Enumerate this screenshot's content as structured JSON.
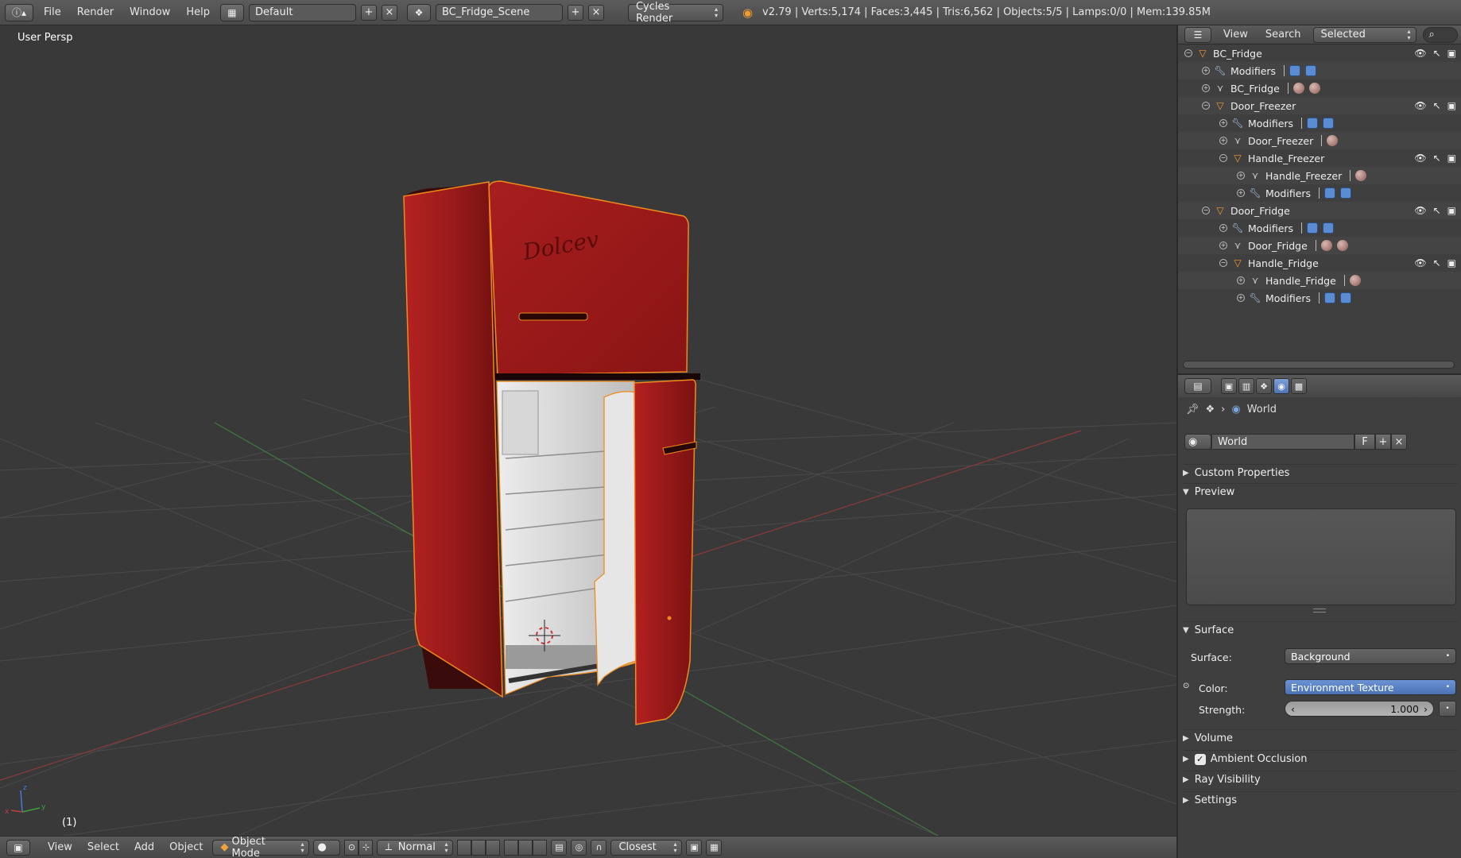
{
  "topbar": {
    "menus": [
      "File",
      "Render",
      "Window",
      "Help"
    ],
    "layout_value": "Default",
    "scene_value": "BC_Fridge_Scene",
    "engine_value": "Cycles Render",
    "stats": "v2.79 | Verts:5,174 | Faces:3,445 | Tris:6,562 | Objects:5/5 | Lamps:0/0 | Mem:139.85M"
  },
  "viewport": {
    "label": "User Persp",
    "frame": "(1)",
    "fridge_brand": "Dolcev"
  },
  "bottombar": {
    "menus": [
      "View",
      "Select",
      "Add",
      "Object"
    ],
    "mode": "Object Mode",
    "pivot": "Normal",
    "snap": "Closest"
  },
  "outliner": {
    "header": {
      "view": "View",
      "search": "Search",
      "filter": "Selected"
    },
    "rows": [
      {
        "label": "BC_Fridge",
        "type": "object",
        "depth": 0,
        "expanded": true,
        "vis": true,
        "extra": "none"
      },
      {
        "label": "Modifiers",
        "type": "modifiers",
        "depth": 1,
        "expanded": false,
        "vis": false,
        "extra": "mods"
      },
      {
        "label": "BC_Fridge",
        "type": "mesh",
        "depth": 1,
        "expanded": false,
        "vis": false,
        "extra": "mats2"
      },
      {
        "label": "Door_Freezer",
        "type": "object",
        "depth": 1,
        "expanded": true,
        "vis": true,
        "extra": "none"
      },
      {
        "label": "Modifiers",
        "type": "modifiers",
        "depth": 2,
        "expanded": false,
        "vis": false,
        "extra": "mods"
      },
      {
        "label": "Door_Freezer",
        "type": "mesh",
        "depth": 2,
        "expanded": false,
        "vis": false,
        "extra": "mats1"
      },
      {
        "label": "Handle_Freezer",
        "type": "object",
        "depth": 2,
        "expanded": true,
        "vis": true,
        "extra": "none"
      },
      {
        "label": "Handle_Freezer",
        "type": "mesh",
        "depth": 3,
        "expanded": false,
        "vis": false,
        "extra": "mats1"
      },
      {
        "label": "Modifiers",
        "type": "modifiers",
        "depth": 3,
        "expanded": false,
        "vis": false,
        "extra": "mods"
      },
      {
        "label": "Door_Fridge",
        "type": "object",
        "depth": 1,
        "expanded": true,
        "vis": true,
        "extra": "none"
      },
      {
        "label": "Modifiers",
        "type": "modifiers",
        "depth": 2,
        "expanded": false,
        "vis": false,
        "extra": "mods"
      },
      {
        "label": "Door_Fridge",
        "type": "mesh",
        "depth": 2,
        "expanded": false,
        "vis": false,
        "extra": "mats2"
      },
      {
        "label": "Handle_Fridge",
        "type": "object",
        "depth": 2,
        "expanded": true,
        "vis": true,
        "extra": "none"
      },
      {
        "label": "Handle_Fridge",
        "type": "mesh",
        "depth": 3,
        "expanded": false,
        "vis": false,
        "extra": "mats1"
      },
      {
        "label": "Modifiers",
        "type": "modifiers",
        "depth": 3,
        "expanded": false,
        "vis": false,
        "extra": "mods"
      }
    ]
  },
  "properties": {
    "breadcrumb": "World",
    "world_name": "World",
    "fake_user": "F",
    "panels": {
      "custom_properties": "Custom Properties",
      "preview": "Preview",
      "surface": "Surface",
      "volume": "Volume",
      "ambient_occlusion": "Ambient Occlusion",
      "ray_visibility": "Ray Visibility",
      "settings": "Settings"
    },
    "surface_label": "Surface:",
    "surface_value": "Background",
    "color_label": "Color:",
    "color_value": "Environment Texture",
    "strength_label": "Strength:",
    "strength_value": "1.000",
    "ambient_occlusion_checked": true
  },
  "colors": {
    "accent_blue": "#5680c2",
    "object_orange": "#f29b2e",
    "fridge_red": "#9b1a1a",
    "selection_outline": "#f08a1c"
  }
}
